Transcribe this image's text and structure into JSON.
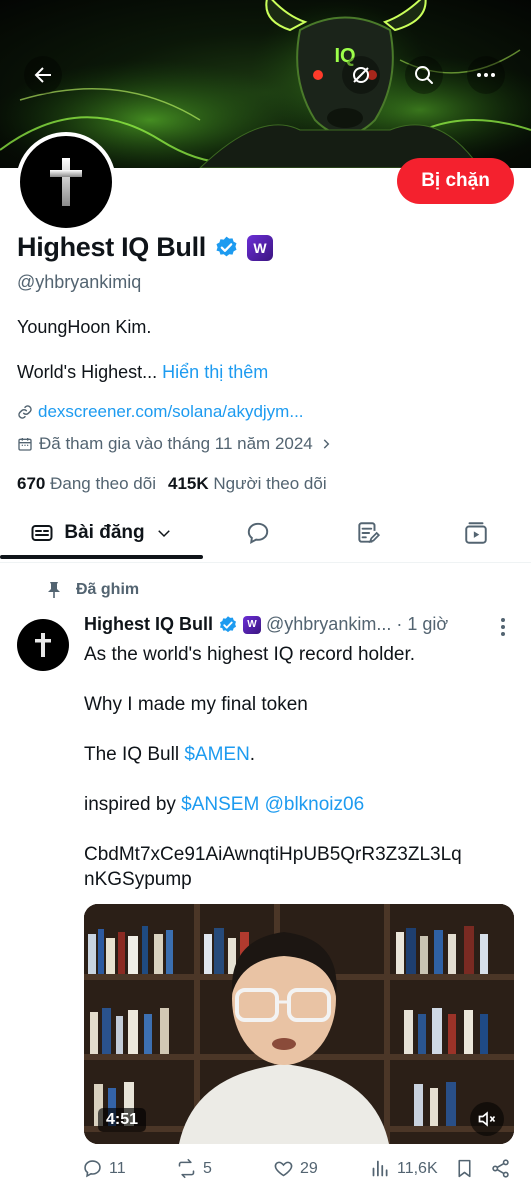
{
  "header": {
    "back_icon": "arrow-left-icon",
    "grok_icon": "grok-icon",
    "search_icon": "search-icon",
    "more_icon": "more-horizontal-icon",
    "banner_text": "IQ"
  },
  "profile": {
    "display_name": "Highest IQ Bull",
    "handle": "@yhbryankimiq",
    "blocked_label": "Bị chặn",
    "bio_line1": "YoungHoon Kim.",
    "bio_line2": "World's Highest...",
    "show_more": "Hiển thị thêm",
    "website": "dexscreener.com/solana/akydjym...",
    "joined": "Đã tham gia vào tháng 11 năm 2024",
    "following_count": "670",
    "following_label": "Đang theo dõi",
    "followers_count": "415K",
    "followers_label": "Người theo dõi",
    "badge_w": "W"
  },
  "tabs": {
    "posts_label": "Bài đăng"
  },
  "post": {
    "pinned_label": "Đã ghim",
    "author_name": "Highest IQ Bull",
    "author_handle": "@yhbryankim...",
    "time": "· 1 giờ",
    "line1": "As the world's highest IQ record holder.",
    "line2": "Why I made my final token",
    "line3_prefix": "The IQ Bull ",
    "line3_link": "$AMEN",
    "line3_suffix": ".",
    "line4_prefix": "inspired by ",
    "line4_link1": "$ANSEM",
    "line4_link2": "@blknoiz06",
    "line5": "CbdMt7xCe91AiAwnqtiHpUB5QrR3Z3ZL3Lq",
    "line6": "nKGSypump",
    "video_duration": "4:51",
    "replies": "11",
    "reposts": "5",
    "likes": "29",
    "views": "11,6K"
  },
  "colors": {
    "accent": "#1d9bf0",
    "blocked": "#f4212e",
    "text": "#0f1419",
    "muted": "#536471"
  }
}
